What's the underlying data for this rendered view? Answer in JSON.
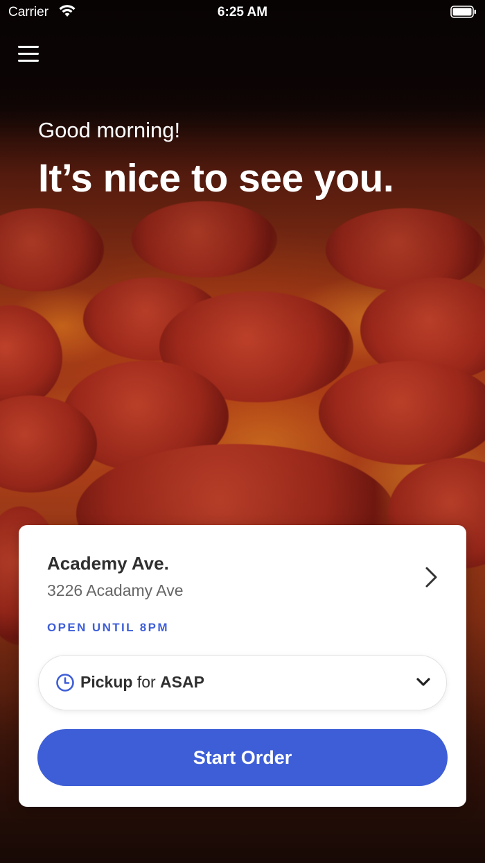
{
  "status_bar": {
    "carrier": "Carrier",
    "time": "6:25 AM"
  },
  "header": {
    "menu_icon": "hamburger-menu-icon",
    "greeting": "Good morning!",
    "headline": "It’s nice to see you."
  },
  "store": {
    "name": "Academy Ave.",
    "address": "3226 Acadamy Ave",
    "hours": "OPEN UNTIL 8PM"
  },
  "order_mode": {
    "icon": "clock-icon",
    "mode": "Pickup",
    "connector": "for",
    "time": "ASAP"
  },
  "actions": {
    "start_order": "Start Order"
  },
  "colors": {
    "accent": "#3e5ed7",
    "text_dark": "#2f2f2f",
    "text_muted": "#666666"
  }
}
